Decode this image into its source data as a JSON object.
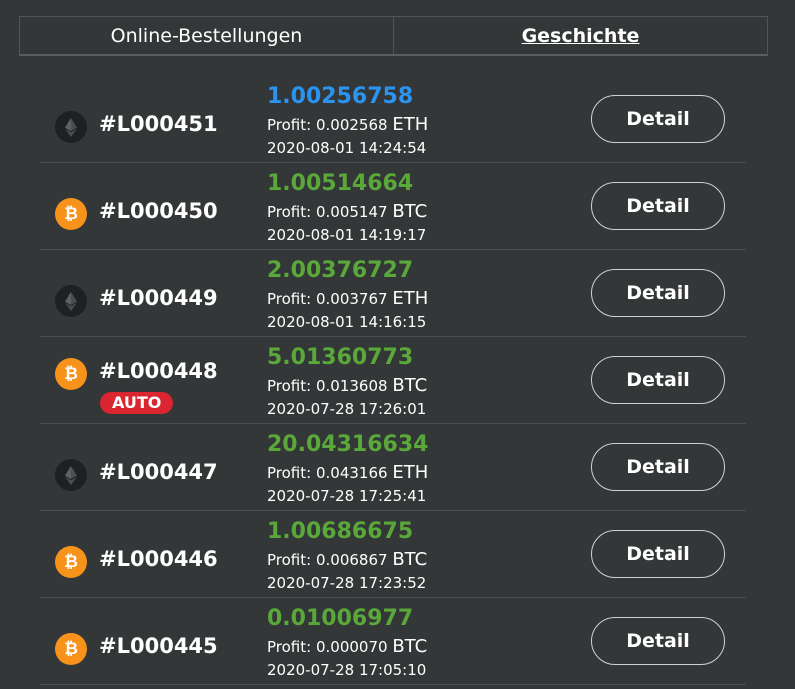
{
  "tabs": [
    {
      "label": "Online-Bestellungen",
      "active": false
    },
    {
      "label": "Geschichte",
      "active": true
    }
  ],
  "orders": [
    {
      "id": "#L000451",
      "coin": "ETH",
      "amount": "1.00256758",
      "amount_color": "blue",
      "profit_label": "Profit:",
      "profit": "0.002568",
      "currency": "ETH",
      "time": "2020-08-01 14:24:54",
      "badge": "",
      "button": "Detail"
    },
    {
      "id": "#L000450",
      "coin": "BTC",
      "amount": "1.00514664",
      "amount_color": "green",
      "profit_label": "Profit:",
      "profit": "0.005147",
      "currency": "BTC",
      "time": "2020-08-01 14:19:17",
      "badge": "",
      "button": "Detail"
    },
    {
      "id": "#L000449",
      "coin": "ETH",
      "amount": "2.00376727",
      "amount_color": "green",
      "profit_label": "Profit:",
      "profit": "0.003767",
      "currency": "ETH",
      "time": "2020-08-01 14:16:15",
      "badge": "",
      "button": "Detail"
    },
    {
      "id": "#L000448",
      "coin": "BTC",
      "amount": "5.01360773",
      "amount_color": "green",
      "profit_label": "Profit:",
      "profit": "0.013608",
      "currency": "BTC",
      "time": "2020-07-28 17:26:01",
      "badge": "AUTO",
      "button": "Detail"
    },
    {
      "id": "#L000447",
      "coin": "ETH",
      "amount": "20.04316634",
      "amount_color": "green",
      "profit_label": "Profit:",
      "profit": "0.043166",
      "currency": "ETH",
      "time": "2020-07-28 17:25:41",
      "badge": "",
      "button": "Detail"
    },
    {
      "id": "#L000446",
      "coin": "BTC",
      "amount": "1.00686675",
      "amount_color": "green",
      "profit_label": "Profit:",
      "profit": "0.006867",
      "currency": "BTC",
      "time": "2020-07-28 17:23:52",
      "badge": "",
      "button": "Detail"
    },
    {
      "id": "#L000445",
      "coin": "BTC",
      "amount": "0.01006977",
      "amount_color": "green",
      "profit_label": "Profit:",
      "profit": "0.000070",
      "currency": "BTC",
      "time": "2020-07-28 17:05:10",
      "badge": "",
      "button": "Detail"
    }
  ],
  "colors": {
    "background": "#343738",
    "amount_green": "#5aa83a",
    "amount_blue": "#2a94f0",
    "badge_red": "#d92631",
    "btc_orange": "#f7931a"
  },
  "icons": {
    "ETH": "ethereum-icon",
    "BTC": "bitcoin-icon"
  }
}
